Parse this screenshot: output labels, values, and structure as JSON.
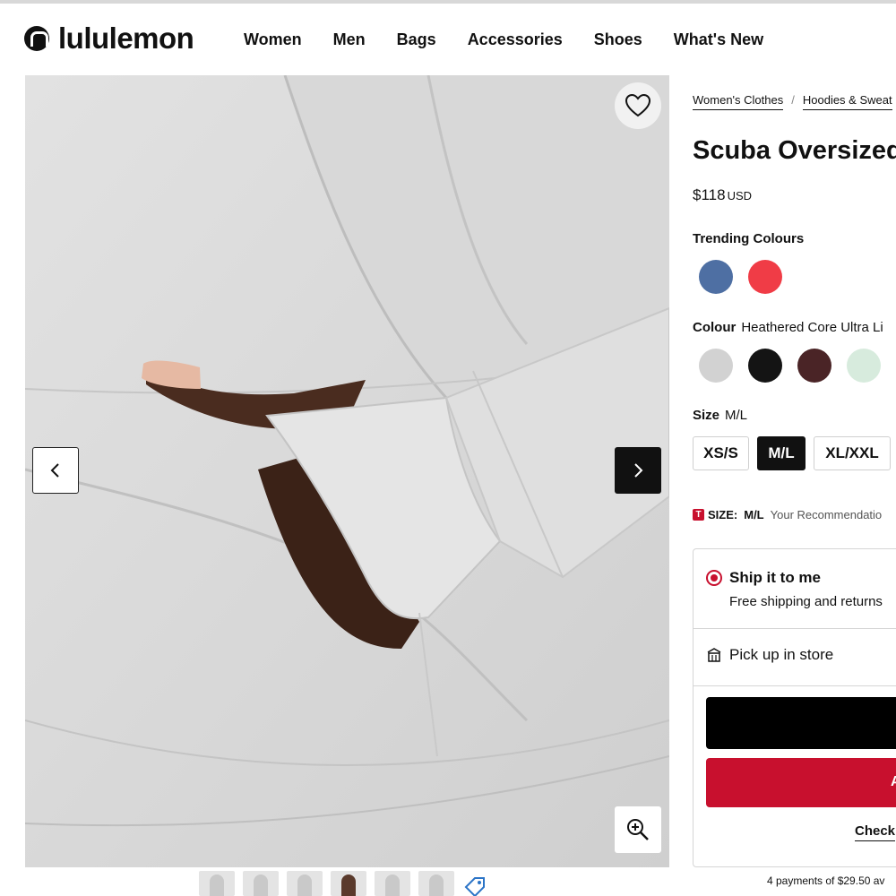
{
  "brand": {
    "name": "lululemon",
    "logo_icon": "lululemon-logo-icon"
  },
  "nav": {
    "items": [
      "Women",
      "Men",
      "Bags",
      "Accessories",
      "Shoes",
      "What's New"
    ]
  },
  "gallery": {
    "wishlist_icon": "heart-icon",
    "prev_icon": "chevron-left-icon",
    "next_icon": "chevron-right-icon",
    "zoom_icon": "zoom-in-icon",
    "thumbnail_count": 6
  },
  "breadcrumb": [
    "Women's Clothes",
    "Hoodies & Sweat"
  ],
  "product": {
    "title": "Scuba Oversized",
    "price": "$118",
    "currency": "USD"
  },
  "trending": {
    "label": "Trending Colours",
    "colors": [
      "#4e6fa3",
      "#f03c46"
    ]
  },
  "colour": {
    "label": "Colour",
    "value": "Heathered Core Ultra Li",
    "colors": [
      "#d2d2d2",
      "#141414",
      "#4a2426",
      "#d7ebdd"
    ]
  },
  "size": {
    "label": "Size",
    "value": "M/L",
    "options": [
      "XS/S",
      "M/L",
      "XL/XXL"
    ],
    "selected": "M/L"
  },
  "fit": {
    "badge": "T",
    "prefix": "SIZE:",
    "size": "M/L",
    "text": "Your Recommendatio"
  },
  "fulfilment": {
    "ship_title": "Ship it to me",
    "ship_sub": "Free shipping and returns",
    "pickup": "Pick up in store",
    "red_button": "A",
    "check_link": "Check"
  },
  "installments": "4 payments of $29.50 av",
  "colors": {
    "accent": "#c8102e",
    "black": "#000000"
  }
}
